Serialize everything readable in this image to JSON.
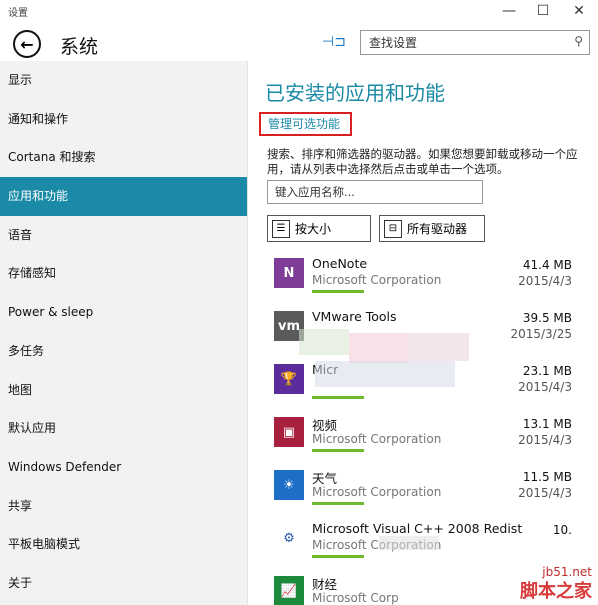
{
  "window": {
    "title": "设置"
  },
  "header": {
    "title": "系统",
    "search_placeholder": "查找设置"
  },
  "sidebar": {
    "items": [
      {
        "label": "显示"
      },
      {
        "label": "通知和操作"
      },
      {
        "label": "Cortana 和搜索"
      },
      {
        "label": "应用和功能",
        "active": true
      },
      {
        "label": "语音"
      },
      {
        "label": "存储感知"
      },
      {
        "label": "Power & sleep"
      },
      {
        "label": "多任务"
      },
      {
        "label": "地图"
      },
      {
        "label": "默认应用"
      },
      {
        "label": "Windows Defender"
      },
      {
        "label": "共享"
      },
      {
        "label": "平板电脑模式"
      },
      {
        "label": "关于"
      }
    ]
  },
  "main": {
    "heading": "已安装的应用和功能",
    "manage_link": "管理可选功能",
    "description": "搜索、排序和筛选器的驱动器。如果您想要卸载或移动一个应用，请从列表中选择然后点击或单击一个选项。",
    "app_search_placeholder": "键入应用名称...",
    "sort_button": "按大小",
    "drive_button": "所有驱动器",
    "apps": [
      {
        "name": "OneNote",
        "publisher": "Microsoft Corporation",
        "size": "41.4 MB",
        "date": "2015/4/3",
        "icon": "onenote-icon",
        "color": "#7d3c98",
        "glyph": "N",
        "bar": true
      },
      {
        "name": "VMware Tools",
        "publisher": "",
        "size": "39.5 MB",
        "date": "2015/3/25",
        "icon": "vmware-icon",
        "color": "#5a5a5a",
        "glyph": "vm",
        "bar": false
      },
      {
        "name": "Micr",
        "publisher": "",
        "size": "23.1 MB",
        "date": "2015/4/3",
        "icon": "trophy-icon",
        "color": "#5b2d9c",
        "glyph": "🏆",
        "bar": true
      },
      {
        "name": "视频",
        "publisher": "Microsoft Corporation",
        "size": "13.1 MB",
        "date": "2015/4/3",
        "icon": "video-icon",
        "color": "#a8203d",
        "glyph": "▣",
        "bar": true
      },
      {
        "name": "天气",
        "publisher": "Microsoft Corporation",
        "size": "11.5 MB",
        "date": "2015/4/3",
        "icon": "weather-icon",
        "color": "#1e6ec8",
        "glyph": "☀",
        "bar": true
      },
      {
        "name": "Microsoft Visual C++ 2008 Redistr",
        "publisher": "Microsoft Corporation",
        "size": "10.",
        "date": "",
        "icon": "installer-icon",
        "color": "#ffffff",
        "glyph": "⚙",
        "bar": true
      },
      {
        "name": "财经",
        "publisher": "Microsoft Corp",
        "size": "",
        "date": "",
        "icon": "finance-icon",
        "color": "#1c8a3a",
        "glyph": "📈",
        "bar": false
      }
    ]
  },
  "watermark": {
    "url": "jb51.net",
    "name": "脚本之家"
  }
}
